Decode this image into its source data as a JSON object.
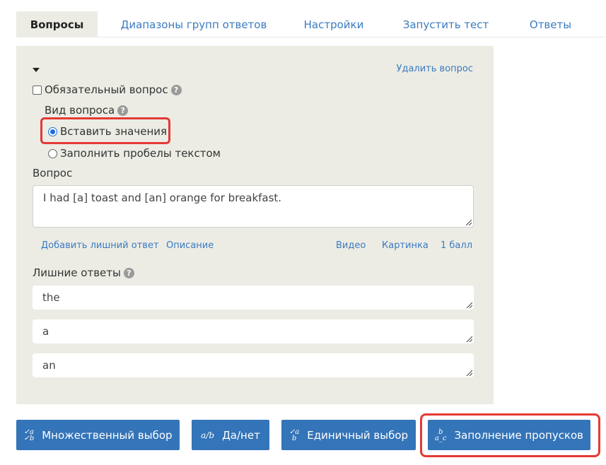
{
  "tabs": [
    {
      "label": "Вопросы",
      "active": true
    },
    {
      "label": "Диапазоны групп ответов",
      "active": false
    },
    {
      "label": "Настройки",
      "active": false
    },
    {
      "label": "Запустить тест",
      "active": false
    },
    {
      "label": "Ответы",
      "active": false
    }
  ],
  "question": {
    "delete_label": "Удалить вопрос",
    "required_label": "Обязательный вопрос",
    "required_checked": false,
    "type_label": "Вид вопроса",
    "type_options": [
      {
        "label": "Вставить значения",
        "checked": true
      },
      {
        "label": "Заполнить пробелы текстом",
        "checked": false
      }
    ],
    "question_label": "Вопрос",
    "question_text": "I had [a] toast and [an] orange for breakfast.",
    "links": {
      "add_extra": "Добавить лишний ответ",
      "description": "Описание",
      "video": "Видео",
      "picture": "Картинка",
      "points": "1 балл"
    },
    "extra_answers_label": "Лишние ответы",
    "extra_answers": [
      "the",
      "a",
      "an"
    ]
  },
  "question_types": [
    {
      "icon_top": "✓a",
      "icon_bottom": "✓b",
      "label": "Множественный выбор"
    },
    {
      "icon_inline": "a/b",
      "label": "Да/нет"
    },
    {
      "icon_top": "✓a",
      "icon_bottom": "b",
      "label": "Единичный выбор"
    },
    {
      "icon_top": "b",
      "icon_bottom": "a_c",
      "label": "Заполнение пропусков",
      "highlighted": true
    }
  ],
  "icons": {
    "help": "?",
    "collapse": "collapse-arrow-icon"
  }
}
